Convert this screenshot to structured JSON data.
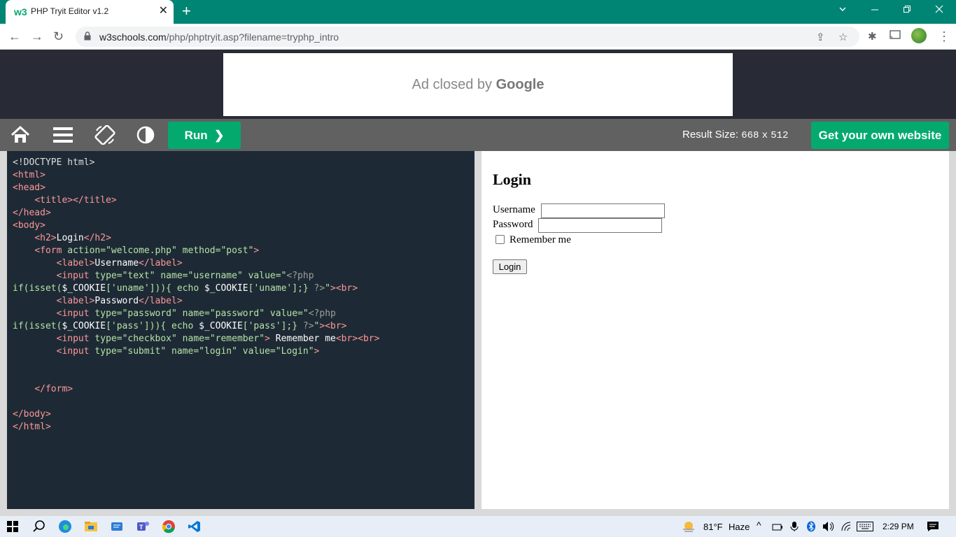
{
  "browser": {
    "tab_title": "PHP Tryit Editor v1.2",
    "tab_favicon": "w3",
    "url_host": "w3schools.com",
    "url_path": "/php/phptryit.asp?filename=tryphp_intro"
  },
  "ad": {
    "text": "Ad closed by",
    "brand": "Google"
  },
  "editor_toolbar": {
    "run_label": "Run",
    "result_size_label": "Result Size:",
    "result_width": "668",
    "result_x": "x",
    "result_height": "512",
    "get_website_label": "Get your own website"
  },
  "result": {
    "heading": "Login",
    "username_label": "Username",
    "password_label": "Password",
    "remember_label": "Remember me",
    "submit_label": "Login"
  },
  "taskbar": {
    "weather": "81°F",
    "weather_desc": "Haze",
    "time": "2:29 PM"
  },
  "colors": {
    "chrome_frame": "#008575",
    "w3_green": "#04aa6d",
    "code_bg": "#1d2a35",
    "editor_bar": "#616161"
  }
}
